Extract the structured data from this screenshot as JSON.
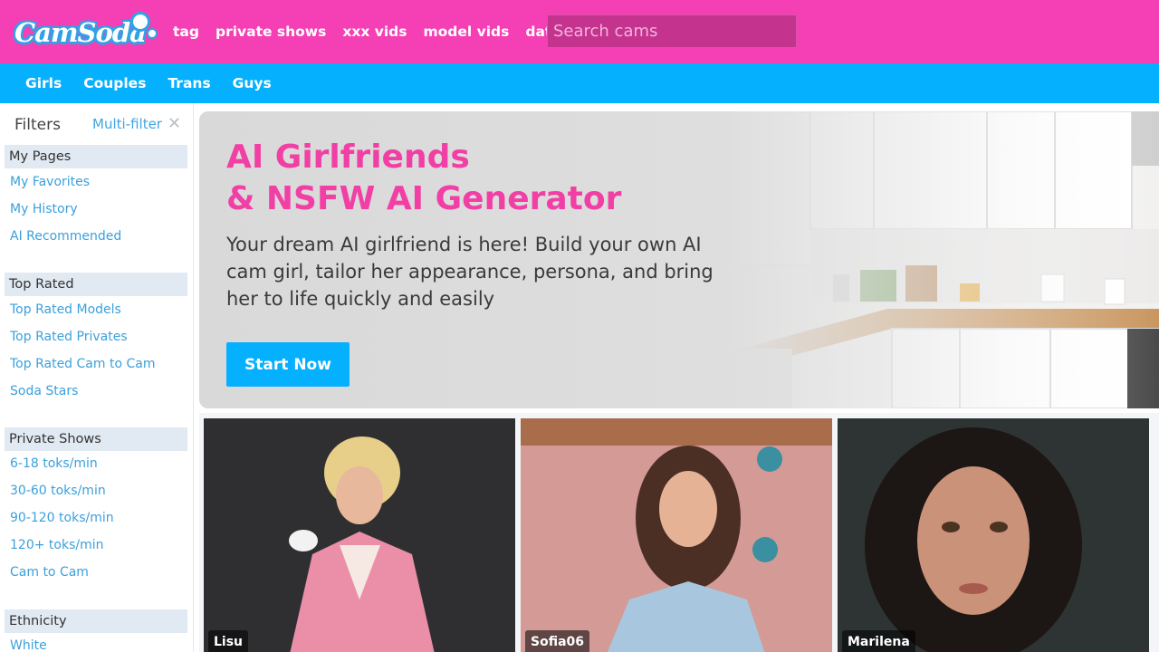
{
  "brand": {
    "name": "CamSoda"
  },
  "topnav": {
    "items": [
      "tag",
      "private shows",
      "xxx vids",
      "model vids",
      "dating"
    ]
  },
  "search": {
    "placeholder": "Search cams"
  },
  "catnav": {
    "items": [
      "Girls",
      "Couples",
      "Trans",
      "Guys"
    ]
  },
  "sidebar": {
    "filters_label": "Filters",
    "multifilter_label": "Multi-filter",
    "sections": [
      {
        "title": "My Pages",
        "links": [
          "My Favorites",
          "My History",
          "AI Recommended"
        ]
      },
      {
        "title": "Top Rated",
        "links": [
          "Top Rated Models",
          "Top Rated Privates",
          "Top Rated Cam to Cam",
          "Soda Stars"
        ]
      },
      {
        "title": "Private Shows",
        "links": [
          "6-18 toks/min",
          "30-60 toks/min",
          "90-120 toks/min",
          "120+ toks/min",
          "Cam to Cam"
        ]
      },
      {
        "title": "Ethnicity",
        "links": [
          "White"
        ]
      }
    ]
  },
  "banner": {
    "title_line1": "AI Girlfriends",
    "title_line2": "& NSFW AI Generator",
    "subtitle": "Your dream AI girlfriend is here! Build your own AI cam girl, tailor her appearance, persona, and bring her to life quickly and easily",
    "cta_label": "Start Now"
  },
  "cards": [
    {
      "name": "Lisu"
    },
    {
      "name": "Sofia06"
    },
    {
      "name": "Marilena"
    }
  ],
  "colors": {
    "brand_pink": "#f53fb4",
    "brand_blue": "#05b0ff",
    "title_pink": "#f13fa6",
    "link_blue": "#3aa0dc"
  }
}
